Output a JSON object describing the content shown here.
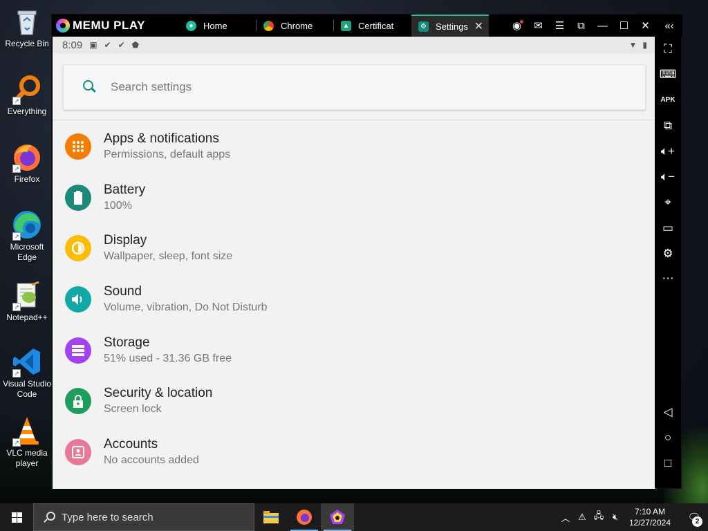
{
  "desktop": {
    "icons": [
      {
        "label": "Recycle Bin",
        "icon": "recycle-bin-icon"
      },
      {
        "label": "Everything",
        "icon": "everything-search-icon"
      },
      {
        "label": "Firefox",
        "icon": "firefox-icon"
      },
      {
        "label": "Microsoft Edge",
        "icon": "edge-icon"
      },
      {
        "label": "Notepad++",
        "icon": "notepadpp-icon"
      },
      {
        "label": "Visual Studio Code",
        "icon": "vscode-icon"
      },
      {
        "label": "VLC media player",
        "icon": "vlc-icon"
      }
    ]
  },
  "emulator": {
    "brand": "MEMU PLAY",
    "tabs": [
      {
        "label": "Home",
        "icon": "home-app-icon",
        "color": "#1fbf9f"
      },
      {
        "label": "Chrome",
        "icon": "chrome-icon",
        "color": "#ffffff"
      },
      {
        "label": "Certificat",
        "icon": "android-app-icon",
        "color": "#1fa37f"
      },
      {
        "label": "Settings",
        "icon": "settings-icon",
        "color": "#0f8f7f",
        "active": true
      }
    ],
    "window_controls": [
      "account-icon",
      "mail-icon",
      "menu-icon",
      "restore-icon",
      "minimize-icon",
      "maximize-icon",
      "close-icon",
      "collapse-sidebar-icon"
    ],
    "sidebar_tools": [
      "fullscreen-icon",
      "keyboard-icon",
      "apk-icon",
      "multi-instance-icon",
      "volume-up-icon",
      "volume-down-icon",
      "location-icon",
      "folder-icon",
      "settings-gear-icon",
      "more-icon",
      "back-icon",
      "home-icon",
      "recents-icon"
    ]
  },
  "android": {
    "status": {
      "time": "8:09"
    },
    "search": {
      "placeholder": "Search settings"
    },
    "settings": [
      {
        "title": "Apps & notifications",
        "subtitle": "Permissions, default apps",
        "icon": "apps-icon",
        "color": "#f57c00"
      },
      {
        "title": "Battery",
        "subtitle": "100%",
        "icon": "battery-icon",
        "color": "#1b8a7a"
      },
      {
        "title": "Display",
        "subtitle": "Wallpaper, sleep, font size",
        "icon": "display-icon",
        "color": "#fbbc05"
      },
      {
        "title": "Sound",
        "subtitle": "Volume, vibration, Do Not Disturb",
        "icon": "sound-icon",
        "color": "#13a8a8"
      },
      {
        "title": "Storage",
        "subtitle": "51% used - 31.36 GB free",
        "icon": "storage-icon",
        "color": "#a142f4"
      },
      {
        "title": "Security & location",
        "subtitle": "Screen lock",
        "icon": "lock-icon",
        "color": "#1e9e5a"
      },
      {
        "title": "Accounts",
        "subtitle": "No accounts added",
        "icon": "accounts-icon",
        "color": "#e8779a"
      }
    ]
  },
  "taskbar": {
    "search_placeholder": "Type here to search",
    "apps": [
      "file-explorer-icon",
      "firefox-icon",
      "memu-icon"
    ],
    "clock_time": "7:10 AM",
    "clock_date": "12/27/2024",
    "notification_count": "2"
  }
}
